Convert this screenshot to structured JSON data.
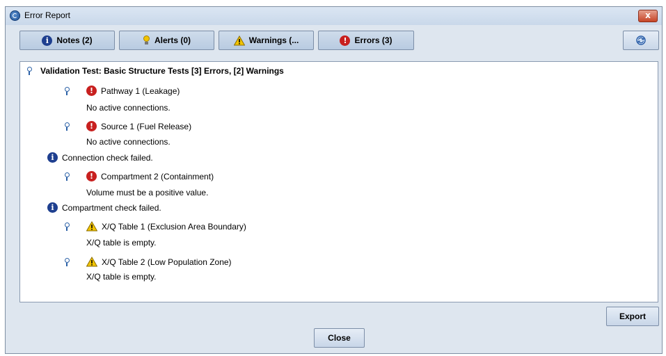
{
  "window": {
    "title": "Error Report",
    "close_glyph": "x"
  },
  "tabs": [
    {
      "label": "Notes (2)",
      "icon": "info-icon"
    },
    {
      "label": "Alerts (0)",
      "icon": "lightbulb-icon"
    },
    {
      "label": "Warnings (...",
      "icon": "warning-icon"
    },
    {
      "label": "Errors (3)",
      "icon": "error-icon"
    }
  ],
  "toolbar": {
    "refresh_icon": "refresh-icon"
  },
  "tree": {
    "root": "Validation Test: Basic Structure Tests [3] Errors, [2] Warnings",
    "items": [
      {
        "title": "Pathway 1 (Leakage)",
        "detail": "No active connections.",
        "severity": "error"
      },
      {
        "title": "Source 1 (Fuel Release)",
        "detail": "No active connections.",
        "severity": "error"
      },
      {
        "title": "Compartment 2 (Containment)",
        "detail": "Volume must be a positive value.",
        "severity": "error"
      },
      {
        "title": "X/Q Table 1 (Exclusion Area Boundary)",
        "detail": "X/Q table is empty.",
        "severity": "warning"
      },
      {
        "title": "X/Q Table 2 (Low Population Zone)",
        "detail": "X/Q table is empty.",
        "severity": "warning"
      }
    ],
    "notes": [
      "Connection check failed.",
      "Compartment check failed."
    ]
  },
  "buttons": {
    "export": "Export",
    "close": "Close"
  },
  "colors": {
    "error": "#c8201f",
    "info": "#1e3f8f",
    "warning": "#f2c400"
  }
}
